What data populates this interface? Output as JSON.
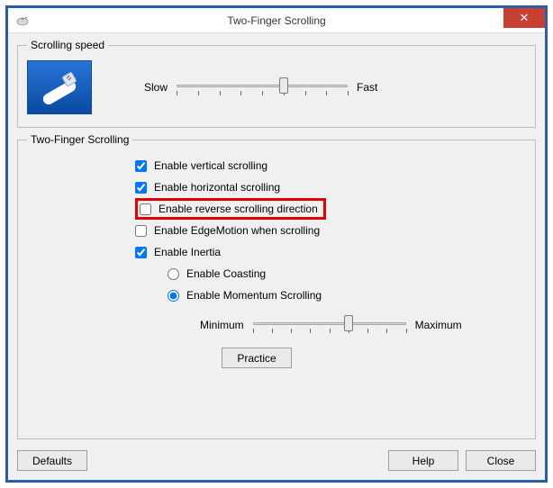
{
  "window": {
    "title": "Two-Finger Scrolling",
    "close_glyph": "✕"
  },
  "speed": {
    "legend": "Scrolling speed",
    "min_label": "Slow",
    "max_label": "Fast",
    "ticks": 9,
    "value": 5
  },
  "twofinger": {
    "legend": "Two-Finger Scrolling",
    "options": {
      "vertical": {
        "label": "Enable vertical scrolling",
        "checked": true
      },
      "horizontal": {
        "label": "Enable horizontal scrolling",
        "checked": true
      },
      "reverse": {
        "label": "Enable reverse scrolling direction",
        "checked": false
      },
      "edgemotion": {
        "label": "Enable EdgeMotion when scrolling",
        "checked": false
      },
      "inertia": {
        "label": "Enable Inertia",
        "checked": true
      }
    },
    "inertia_mode": {
      "coasting": {
        "label": "Enable Coasting"
      },
      "momentum": {
        "label": "Enable Momentum Scrolling"
      },
      "selected": "momentum"
    },
    "momentum_slider": {
      "min_label": "Minimum",
      "max_label": "Maximum",
      "ticks": 9,
      "value": 5
    },
    "practice_label": "Practice"
  },
  "buttons": {
    "defaults": "Defaults",
    "help": "Help",
    "close": "Close"
  }
}
